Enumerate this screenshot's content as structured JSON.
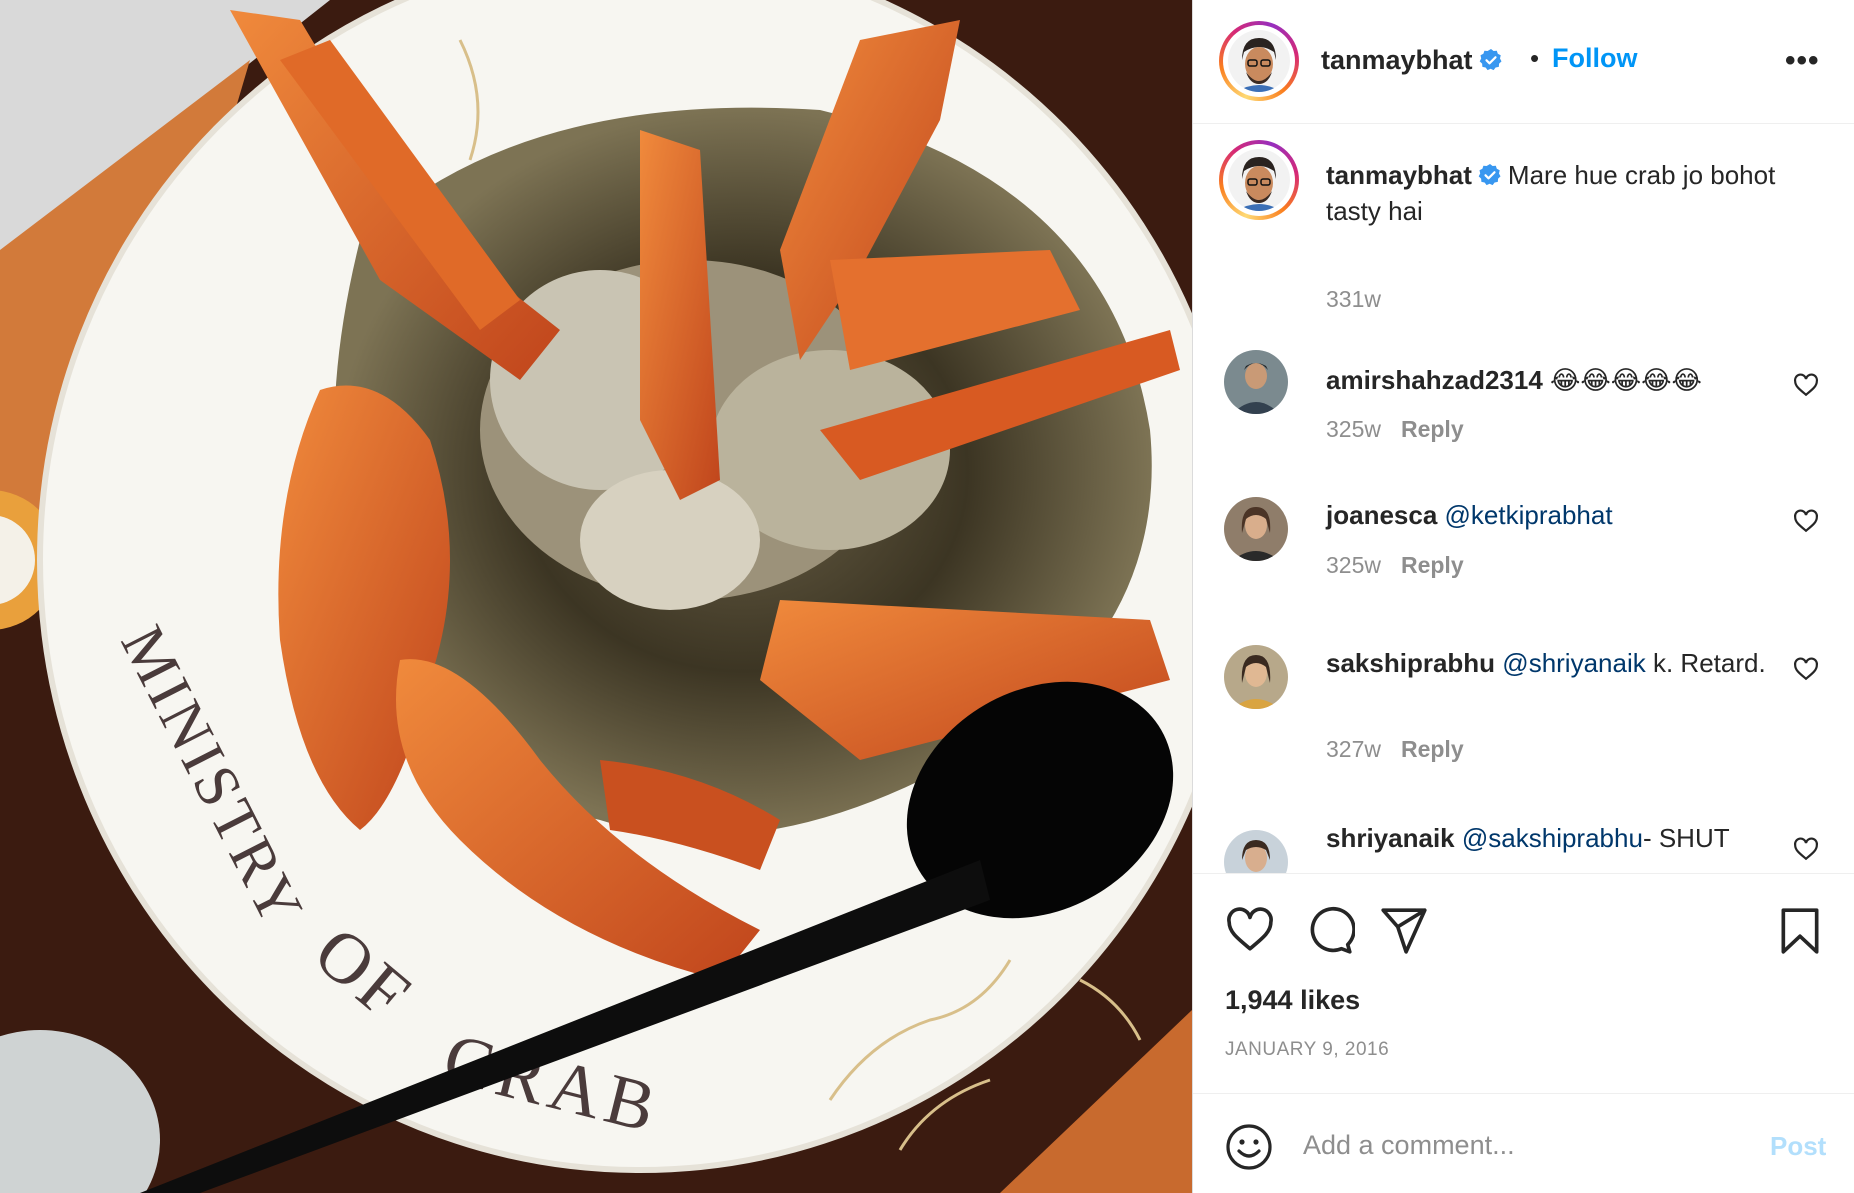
{
  "photo": {
    "plate_text_1": "MINISTRY",
    "plate_text_2": "OF",
    "plate_text_3": "CRAB"
  },
  "header": {
    "username": "tanmaybhat",
    "verified_icon": "verified-badge-icon",
    "dot": "•",
    "follow_label": "Follow",
    "more_icon": "•••"
  },
  "caption": {
    "username": "tanmaybhat",
    "text": "Mare hue crab jo bohot tasty hai",
    "age": "331w"
  },
  "comments": [
    {
      "username": "amirshahzad2314",
      "mention": "",
      "text": "😂😂😂😂😂",
      "age": "325w",
      "reply_label": "Reply"
    },
    {
      "username": "joanesca",
      "mention": "@ketkiprabhat",
      "text": "",
      "age": "325w",
      "reply_label": "Reply"
    },
    {
      "username": "sakshiprabhu",
      "mention": "@shriyanaik",
      "text": " k. Retard.",
      "age": "327w",
      "reply_label": "Reply"
    },
    {
      "username": "shriyanaik",
      "mention": "@sakshiprabhu",
      "text": "- SHUT",
      "age": "",
      "reply_label": ""
    }
  ],
  "actions": {
    "like_icon": "heart-icon",
    "comment_icon": "comment-bubble-icon",
    "share_icon": "paper-plane-icon",
    "save_icon": "bookmark-icon",
    "likes_text": "1,944 likes",
    "date_text": "JANUARY 9, 2016"
  },
  "add_comment": {
    "emoji_icon": "smiley-icon",
    "placeholder": "Add a comment...",
    "post_label": "Post"
  },
  "colors": {
    "link_blue": "#0095f6",
    "mention_blue": "#00376b",
    "post_disabled": "#b2dffc",
    "verified_blue": "#3897f0"
  }
}
